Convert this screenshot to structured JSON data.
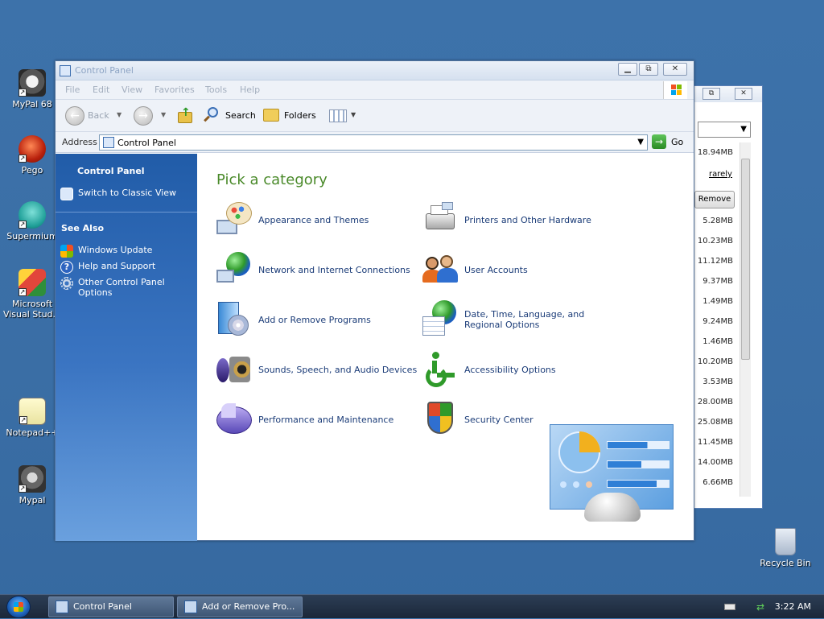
{
  "desktop": {
    "icons": [
      {
        "label": "MyPal 68"
      },
      {
        "label": "Pego"
      },
      {
        "label": "Supermium"
      },
      {
        "label": "Microsoft Visual Stud..."
      },
      {
        "label": "Notepad++"
      },
      {
        "label": "Mypal"
      },
      {
        "label": "Recycle Bin"
      }
    ]
  },
  "background_window": {
    "link": "rarely",
    "remove_button": "Remove",
    "sizes": [
      "18.94MB",
      "5.28MB",
      "10.23MB",
      "11.12MB",
      "9.37MB",
      "1.49MB",
      "9.24MB",
      "1.46MB",
      "10.20MB",
      "3.53MB",
      "28.00MB",
      "25.08MB",
      "11.45MB",
      "14.00MB",
      "6.66MB"
    ]
  },
  "window": {
    "title": "Control Panel",
    "menu": [
      "File",
      "Edit",
      "View",
      "Favorites",
      "Tools",
      "Help"
    ],
    "toolbar": {
      "back": "Back",
      "search": "Search",
      "folders": "Folders"
    },
    "address": {
      "label": "Address",
      "value": "Control Panel",
      "go": "Go"
    }
  },
  "sidepane": {
    "section1_title": "Control Panel",
    "switch_view": "Switch to Classic View",
    "see_also_title": "See Also",
    "links": [
      "Windows Update",
      "Help and Support",
      "Other Control Panel Options"
    ]
  },
  "content": {
    "heading": "Pick a category",
    "categories": [
      {
        "label": "Appearance and Themes",
        "icon": "appearance-icon"
      },
      {
        "label": "Printers and Other Hardware",
        "icon": "printer-icon"
      },
      {
        "label": "Network and Internet Connections",
        "icon": "network-icon"
      },
      {
        "label": "User Accounts",
        "icon": "users-icon"
      },
      {
        "label": "Add or Remove Programs",
        "icon": "programs-icon"
      },
      {
        "label": "Date, Time, Language, and Regional Options",
        "icon": "globe-calendar-icon"
      },
      {
        "label": "Sounds, Speech, and Audio Devices",
        "icon": "audio-icon"
      },
      {
        "label": "Accessibility Options",
        "icon": "accessibility-icon"
      },
      {
        "label": "Performance and Maintenance",
        "icon": "performance-icon"
      },
      {
        "label": "Security Center",
        "icon": "shield-icon"
      }
    ]
  },
  "taskbar": {
    "tasks": [
      "Control Panel",
      "Add or Remove Pro..."
    ],
    "clock": "3:22 AM"
  }
}
